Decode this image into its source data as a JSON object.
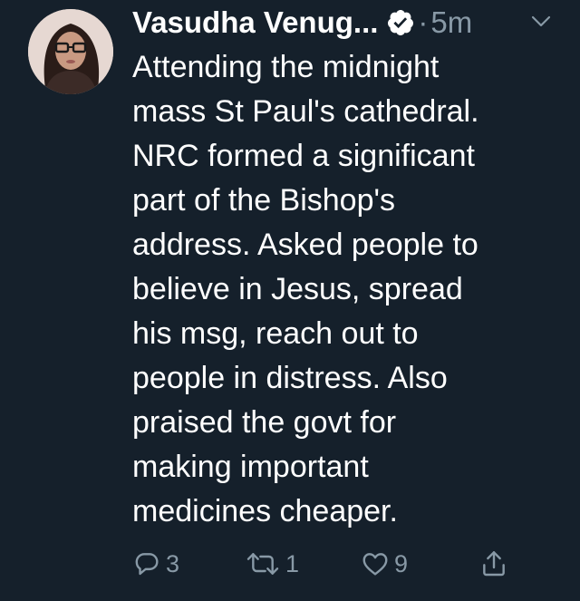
{
  "tweet": {
    "author": {
      "display_name": "Vasudha Venug...",
      "verified_icon": "verified-badge-icon",
      "avatar_icon": "avatar"
    },
    "separator": "·",
    "timestamp": "5m",
    "menu_icon": "chevron-down-icon",
    "text_lines": [
      "Attending the midnight",
      "mass St Paul's cathedral.",
      "NRC formed a significant",
      "part of the Bishop's",
      "address. Asked people to",
      "believe in Jesus, spread",
      "his msg, reach out to",
      "people in distress. Also",
      "praised the govt for",
      "making important",
      "medicines cheaper."
    ],
    "actions": {
      "reply": {
        "icon": "reply-icon",
        "count": "3"
      },
      "retweet": {
        "icon": "retweet-icon",
        "count": "1"
      },
      "like": {
        "icon": "heart-icon",
        "count": "9"
      },
      "share": {
        "icon": "share-icon"
      }
    }
  },
  "colors": {
    "background": "#15202b",
    "text": "#ffffff",
    "secondary": "#8899a6"
  }
}
